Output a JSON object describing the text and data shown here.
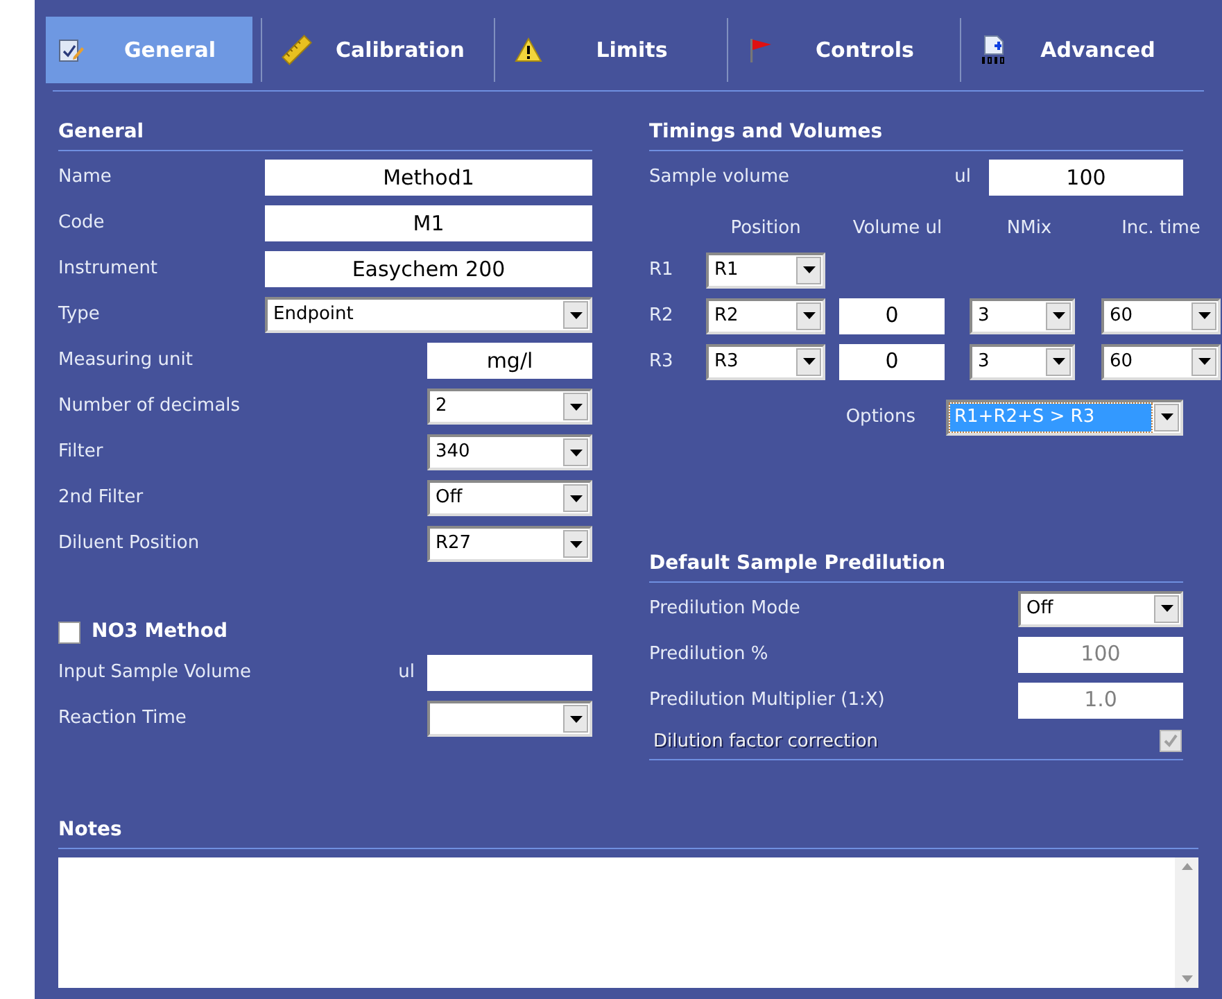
{
  "tabs": [
    {
      "label": "General",
      "selected": true
    },
    {
      "label": "Calibration",
      "selected": false
    },
    {
      "label": "Limits",
      "selected": false
    },
    {
      "label": "Controls",
      "selected": false
    },
    {
      "label": "Advanced",
      "selected": false
    }
  ],
  "general": {
    "title": "General",
    "fields": [
      {
        "label": "Name",
        "kind": "field",
        "value": "Method1"
      },
      {
        "label": "Code",
        "kind": "field",
        "value": "M1"
      },
      {
        "label": "Instrument",
        "kind": "field",
        "value": "Easychem 200"
      },
      {
        "label": "Type",
        "kind": "dropdown",
        "value": "Endpoint"
      },
      {
        "label": "Measuring unit",
        "kind": "short-field",
        "value": "mg/l"
      },
      {
        "label": "Number of decimals",
        "kind": "short-dropdown",
        "value": "2"
      },
      {
        "label": "Filter",
        "kind": "short-dropdown",
        "value": "340"
      },
      {
        "label": "2nd Filter",
        "kind": "short-dropdown",
        "value": "Off"
      },
      {
        "label": "Diluent Position",
        "kind": "short-dropdown",
        "value": "R27"
      }
    ]
  },
  "no3": {
    "label": "NO3 Method",
    "checked": false,
    "fields": [
      {
        "label": "Input Sample Volume",
        "unit": "ul",
        "kind": "short-field"
      },
      {
        "label": "Reaction Time",
        "kind": "short-dropdown"
      }
    ]
  },
  "timings": {
    "title": "Timings and Volumes",
    "sample_volume": {
      "label": "Sample volume",
      "unit": "ul",
      "value": "100"
    },
    "columns": [
      "Position",
      "Volume ul",
      "NMix",
      "Inc. time"
    ],
    "rows": [
      {
        "label": "R1",
        "position": "R1"
      },
      {
        "label": "R2",
        "position": "R2",
        "volume": "0",
        "nmix": "3",
        "inc_time": "60"
      },
      {
        "label": "R3",
        "position": "R3",
        "volume": "0",
        "nmix": "3",
        "inc_time": "60"
      }
    ],
    "options": {
      "label": "Options",
      "value": "R1+R2+S > R3",
      "focused": true
    }
  },
  "predilution": {
    "title": "Default Sample Predilution",
    "fields": [
      {
        "label": "Predilution Mode",
        "kind": "dropdown",
        "value": "Off",
        "disabled": false
      },
      {
        "label": "Predilution %",
        "kind": "field",
        "value": "100",
        "disabled": true
      },
      {
        "label": "Predilution Multiplier (1:X)",
        "kind": "field",
        "value": "1.0",
        "disabled": true
      }
    ],
    "correction": {
      "label": "Dilution factor correction",
      "checked": true,
      "disabled": true
    }
  },
  "notes": {
    "title": "Notes"
  }
}
